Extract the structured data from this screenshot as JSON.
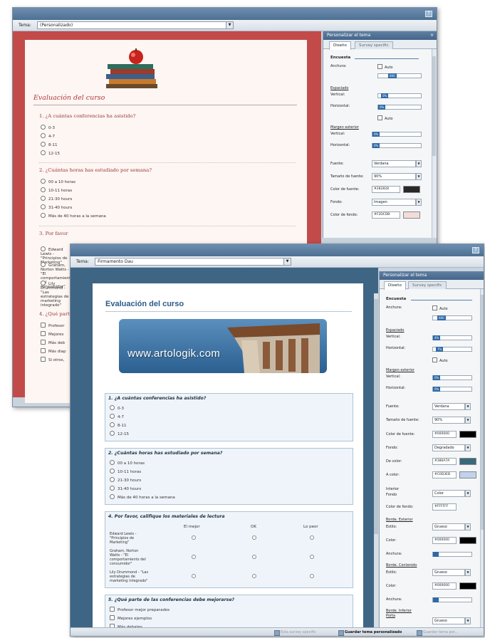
{
  "back_window": {
    "toolbar": {
      "theme_label": "Tema:",
      "theme_value": "(Personalizado)"
    },
    "form": {
      "title": "Evaluación del curso",
      "q1": "1. ¿A cuántas conferencias ha asistido?",
      "q1_options": [
        "0-3",
        "4-7",
        "8-11",
        "12-15"
      ],
      "q2": "2. ¿Cuántas horas has estudiado por semana?",
      "q2_options": [
        "00 a 10 horas",
        "10-11 horas",
        "21-30 hours",
        "31-40 hours",
        "Más de 40 horas a la semana"
      ],
      "q3": "3. Por favor",
      "q3_rows": [
        "Edward Lewis - \"Principios de Marketing\"",
        "Graham, Norton Watts - \"El comportamiento del consumidor\"",
        "Lily Drummond - \"Las estrategias de marketing integrado\""
      ],
      "q4": "4. ¿Qué parte",
      "q4_options": [
        "Profesor",
        "Mejores",
        "Más deb",
        "Más diap",
        "Si otros,"
      ]
    },
    "panel": {
      "header": "Personalizar el tema",
      "tab_design": "Diseño",
      "tab_survey": "Survey specific",
      "section": "Encuesta",
      "width_label": "Anchura:",
      "width_auto": "Auto",
      "width_value": "600",
      "padding_label": "Espaciado",
      "vertical_label": "Vertical:",
      "vertical_value": "0%",
      "horizontal_label": "Horizontal:",
      "horizontal_value": "0%",
      "auto_label": "Auto",
      "outer_margin_label": "Margen exterior",
      "outer_vertical_value": "0%",
      "outer_horizontal_value": "0%",
      "font_label": "Fuente:",
      "font_value": "Verdana",
      "font_size_label": "Tamaño de fuente:",
      "font_size_value": "90%",
      "font_color_label": "Color de fuente:",
      "font_color_value": "#282828",
      "background_label": "Fondo:",
      "background_value": "Imagen",
      "background_color_label": "Color de fondo:",
      "background_color_value": "#F2DCDB"
    }
  },
  "front_window": {
    "toolbar": {
      "theme_label": "Tema:",
      "theme_value": "Firmamento Dau"
    },
    "form": {
      "title": "Evaluación del curso",
      "banner_text": "www.artologik.com",
      "q1": "1. ¿A cuántas conferencias ha asistido?",
      "q1_options": [
        "0-3",
        "4-7",
        "8-11",
        "12-15"
      ],
      "q2": "2. ¿Cuántas horas has estudiado por semana?",
      "q2_options": [
        "00 a 10 horas",
        "10-11 horas",
        "21-30 hours",
        "31-40 hours",
        "Más de 40 horas a la semana"
      ],
      "q3": "4. Por favor, califique los materiales de lectura",
      "q3_cols": [
        "El mejor",
        "OK",
        "Lo peor"
      ],
      "q3_rows": [
        "Edward Lewis - \"Principios de Marketing\"",
        "Graham, Norton Watts - \"El comportamiento del consumidor\"",
        "Lily Drummond - \"Las estrategias de marketing integrado\""
      ],
      "q4": "5. ¿Qué parte de las conferencias debe mejorarse?",
      "q4_options": [
        "Profesor mejor preparados",
        "Mejores ejemplos",
        "Más debates"
      ]
    },
    "panel": {
      "header": "Personalizar el tema",
      "tab_design": "Diseño",
      "tab_survey": "Survey specific",
      "section": "Encuesta",
      "width_label": "Anchura:",
      "width_auto": "Auto",
      "width_value": "600",
      "padding_label": "Espaciado",
      "vertical_label": "Vertical:",
      "vertical_value": "4%",
      "horizontal_label": "Horizontal:",
      "horizontal_value": "7%",
      "auto_label": "Auto",
      "outer_margin_label": "Margen exterior",
      "outer_vertical_value": "0%",
      "outer_horizontal_value": "0%",
      "font_label": "Fuente:",
      "font_value": "Verdana",
      "font_size_label": "Tamaño de fuente:",
      "font_size_value": "90%",
      "font_color_label": "Color de fuente:",
      "font_color_value": "#000000",
      "background_label": "Fondo:",
      "background_value": "Degradado",
      "from_color_label": "De color:",
      "from_color_value": "#386A7A",
      "to_color_label": "A color:",
      "to_color_value": "#C0D3EB",
      "inner_bg_label": "Interior\nFondo",
      "inner_bg_value": "Color",
      "bg_color_label": "Color de fondo:",
      "bg_color_value": "#FFFFFF",
      "outer_border_label": "Borde. Exterior",
      "style_label": "Estilo:",
      "style_value": "Grueso",
      "color_label": "Color:",
      "border_color_value": "#000000",
      "width2_label": "Anchura:",
      "inner_border_label": "Borde. Contenido",
      "style2_value": "Grueso",
      "border2_color_value": "#000000",
      "bottom_border_label": "Borde. Inferior\nPorta",
      "style3_value": "Grueso"
    },
    "statusbar": {
      "btn1": "Esta survey specific",
      "btn2": "Guardar tema personalizado",
      "btn3": "Guardar tema por..."
    }
  },
  "colors": {
    "back_canvas": "#c24b4a",
    "front_canvas": "#3f6585",
    "panel_header": "#4f7194",
    "back_title": "#b23a3a",
    "front_title": "#2a5b89"
  }
}
